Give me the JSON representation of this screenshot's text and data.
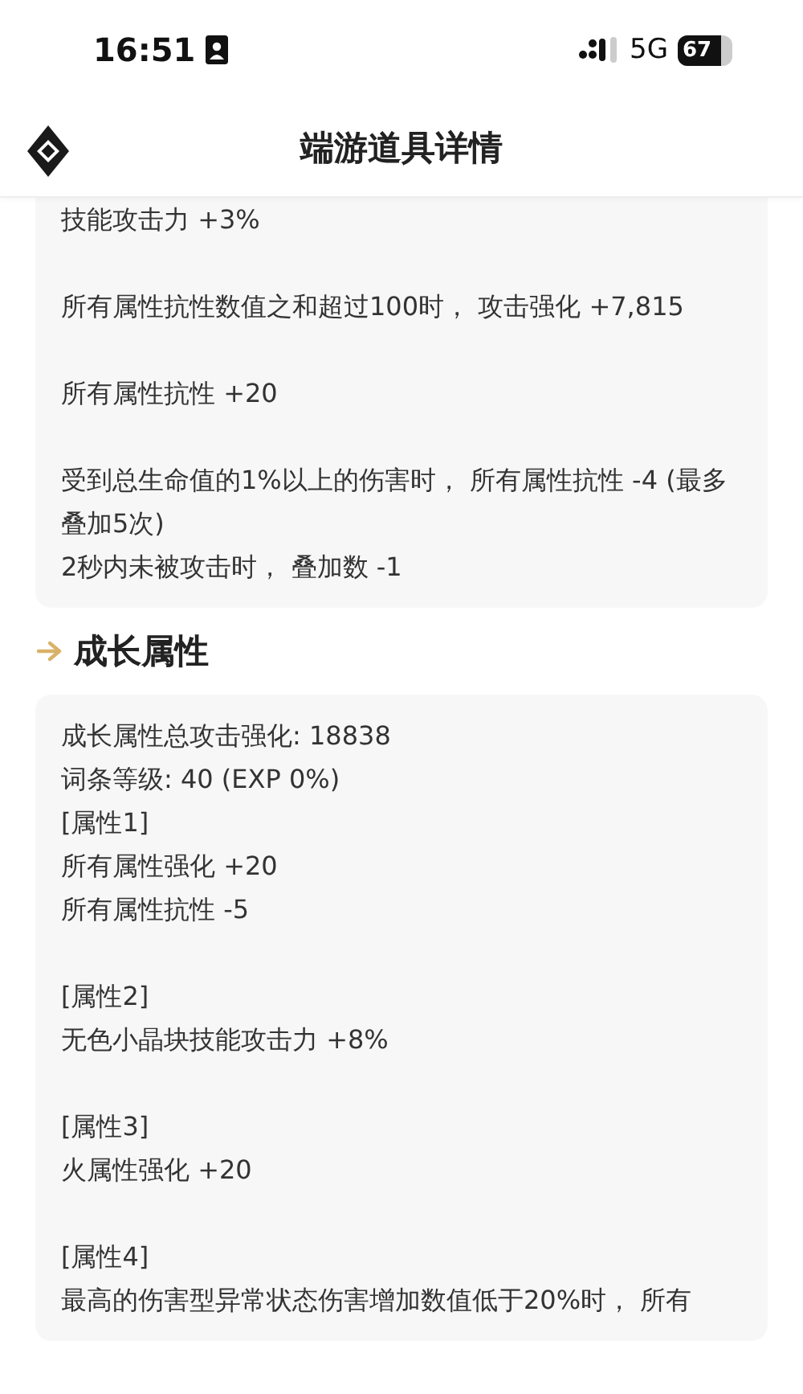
{
  "status_bar": {
    "time": "16:51",
    "network": "5G",
    "battery": "67"
  },
  "header": {
    "title": "端游道具详情"
  },
  "sections": [
    {
      "blocks": [
        [
          "技能攻击力 +3%"
        ],
        [
          "所有属性抗性数值之和超过100时， 攻击强化 +7,815"
        ],
        [
          "所有属性抗性 +20"
        ],
        [
          "受到总生命值的1%以上的伤害时， 所有属性抗性 -4 (最多叠加5次)",
          "2秒内未被攻击时， 叠加数 -1"
        ]
      ]
    },
    {
      "heading": "成长属性",
      "blocks": [
        [
          "成长属性总攻击强化: 18838",
          "词条等级: 40 (EXP 0%)",
          "[属性1]",
          "所有属性强化 +20",
          "所有属性抗性 -5"
        ],
        [
          "[属性2]",
          "无色小晶块技能攻击力 +8%"
        ],
        [
          "[属性3]",
          "火属性强化 +20"
        ],
        [
          "[属性4]",
          "最高的伤害型异常状态伤害增加数值低于20%时， 所有"
        ]
      ]
    }
  ]
}
